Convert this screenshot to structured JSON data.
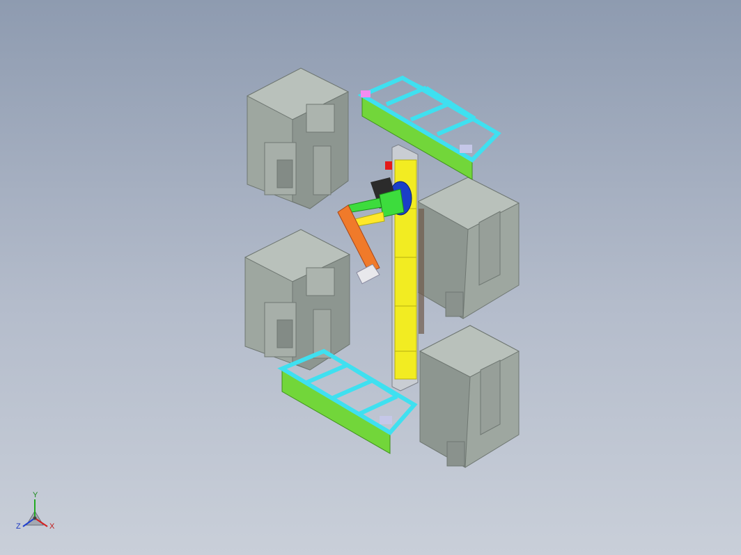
{
  "viewport": {
    "background_top": "#8e9bb0",
    "background_bottom": "#c9cfd9"
  },
  "colors": {
    "machine_face": "#9ea7a0",
    "machine_light": "#b9c1bb",
    "machine_dark": "#7f8782",
    "rack_frame": "#3fe0f0",
    "rack_panel": "#72d63a",
    "rail": "#f2ec22",
    "robot_orange": "#f07a2a",
    "robot_green": "#3ddc3d",
    "robot_blue": "#1a3fc8",
    "robot_yellow": "#ffe82a"
  },
  "triad": {
    "x_label": "X",
    "y_label": "Y",
    "z_label": "Z",
    "x_color": "#d42020",
    "y_color": "#22aa22",
    "z_color": "#2040d0"
  }
}
